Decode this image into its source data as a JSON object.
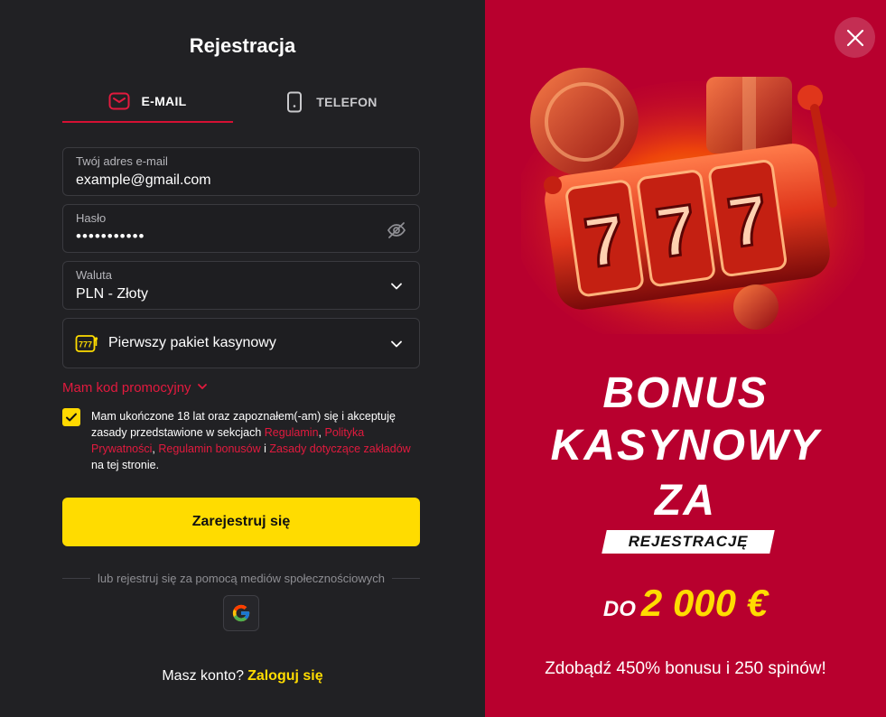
{
  "form": {
    "title": "Rejestracja",
    "tabs": [
      {
        "label": "E-MAIL",
        "icon": "envelope-icon"
      },
      {
        "label": "TELEFON",
        "icon": "phone-icon"
      }
    ],
    "email": {
      "label": "Twój adres e-mail",
      "value": "example@gmail.com"
    },
    "password": {
      "label": "Hasło",
      "value": "•••••••••••",
      "toggle_icon": "eye-off-icon"
    },
    "currency": {
      "label": "Waluta",
      "value": "PLN - Złoty"
    },
    "package": {
      "value": "Pierwszy pakiet kasynowy",
      "icon": "slot-777-icon"
    },
    "promo_label": "Mam kod promocyjny",
    "consent": {
      "checked": true,
      "part1": "Mam ukończone 18 lat oraz zapoznałem(-am) się i akceptuję zasady przedstawione w sekcjach ",
      "link1": "Regulamin",
      "sep1": ", ",
      "link2": "Polityka Prywatności",
      "sep2": ", ",
      "link3": "Regulamin bonusów",
      "sep3": " i ",
      "link4": "Zasady dotyczące zakładów",
      "part2": " na tej stronie."
    },
    "register_label": "Zarejestruj się",
    "social_label": "lub rejestruj się za pomocą mediów społecznościowych",
    "account_text": "Masz konto?",
    "login_label": "Zaloguj się"
  },
  "promo_panel": {
    "line1": "BONUS",
    "line2": "KASYNOWY",
    "line3": "ZA",
    "tag": "REJESTRACJĘ",
    "amount_prefix": "DO",
    "amount": "2 000 €",
    "subtitle": "Zdobądź 450% bonusu i 250 spinów!"
  },
  "colors": {
    "accent": "#d51033",
    "yellow": "#ffdc00",
    "panel": "#b8002e"
  }
}
